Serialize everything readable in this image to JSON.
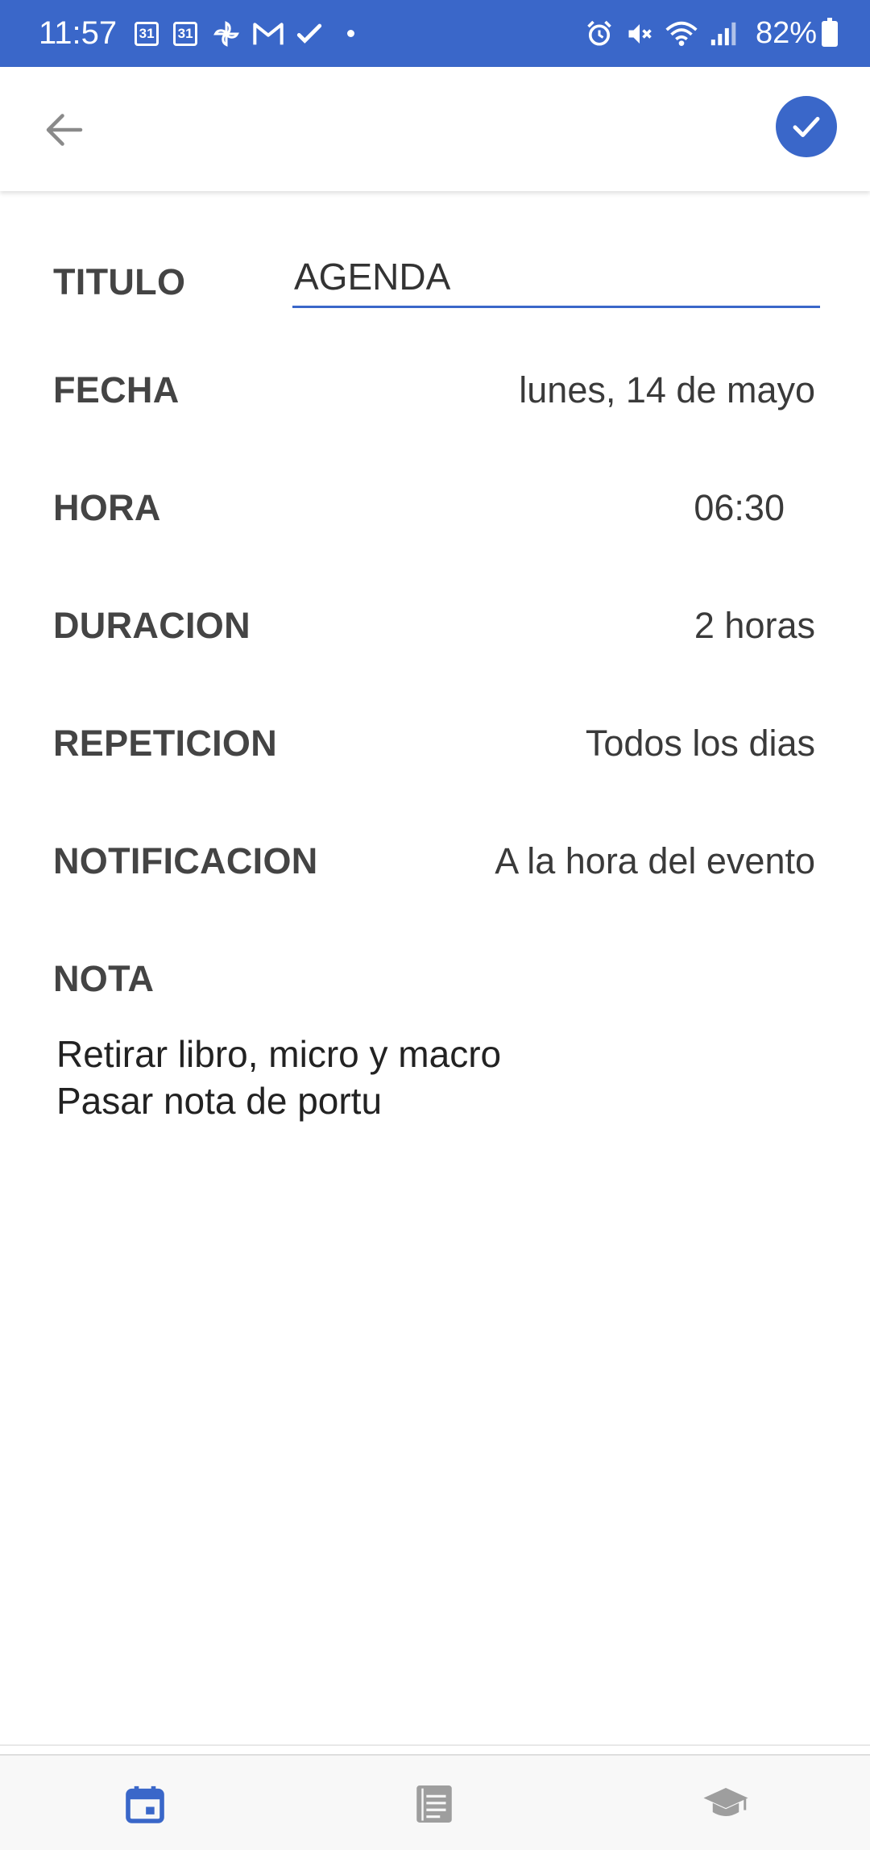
{
  "status_bar": {
    "time": "11:57",
    "calendar_badge_1": "31",
    "calendar_badge_2": "31",
    "battery": "82%",
    "icons": [
      "calendar-icon",
      "calendar-icon",
      "pinwheel-icon",
      "gmail-icon",
      "check-icon",
      "dot-icon",
      "alarm-icon",
      "mute-icon",
      "wifi-icon",
      "signal-icon",
      "battery-icon"
    ]
  },
  "app_bar": {
    "back_icon": "arrow-back-icon",
    "confirm_icon": "check-icon"
  },
  "form": {
    "title_label": "TITULO",
    "title_value": "AGENDA",
    "date_label": "FECHA",
    "date_value": "lunes, 14 de mayo",
    "time_label": "HORA",
    "time_value": "06:30",
    "duration_label": "DURACION",
    "duration_value": "2 horas",
    "repeat_label": "REPETICION",
    "repeat_value": "Todos los dias",
    "notification_label": "NOTIFICACION",
    "notification_value": "A la hora del evento",
    "note_label": "NOTA",
    "note_value": "Retirar libro, micro y macro\nPasar nota de portu"
  },
  "bottom_nav": {
    "items": [
      {
        "icon": "calendar-icon",
        "active": true
      },
      {
        "icon": "notes-icon",
        "active": false
      },
      {
        "icon": "graduation-cap-icon",
        "active": false
      }
    ]
  },
  "colors": {
    "accent": "#3a67c9",
    "text": "#3b3b3b",
    "inactive_icon": "#9e9e9e"
  }
}
